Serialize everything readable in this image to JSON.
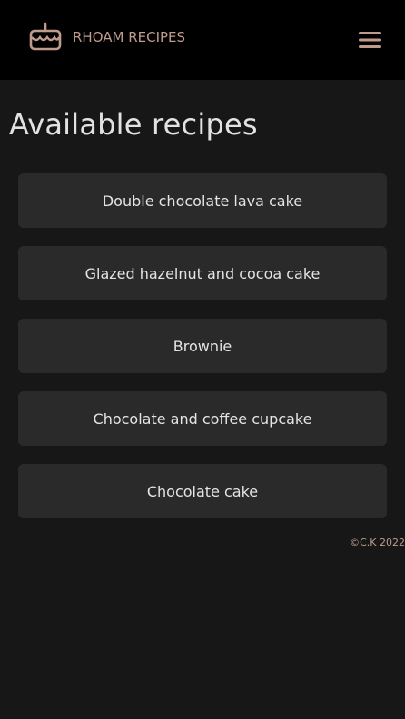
{
  "navbar": {
    "logo_icon": "cake-icon",
    "brand_name": "RHOAM RECIPES",
    "menu_icon": "hamburger-menu-icon",
    "accent_color": "#bf9b8e"
  },
  "main": {
    "title": "Available recipes",
    "recipes": [
      {
        "label": "Double chocolate lava cake"
      },
      {
        "label": "Glazed hazelnut and cocoa cake"
      },
      {
        "label": "Brownie"
      },
      {
        "label": "Chocolate and coffee cupcake"
      },
      {
        "label": "Chocolate cake"
      }
    ]
  },
  "footer": {
    "copyright": "©C.K 2022"
  }
}
